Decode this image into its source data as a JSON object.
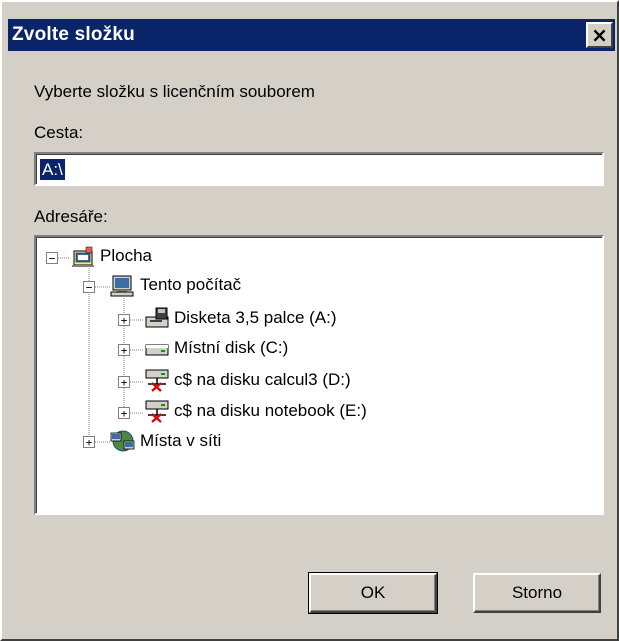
{
  "window": {
    "title": "Zvolte složku",
    "close_symbol": "×"
  },
  "description": "Vyberte složku s licenčním souborem",
  "path": {
    "label": "Cesta:",
    "value": "A:\\"
  },
  "directories": {
    "label": "Adresáře:",
    "tree": [
      {
        "label": "Plocha",
        "icon": "desktop-icon",
        "expander": "−"
      },
      {
        "label": "Tento počítač",
        "icon": "my-computer-icon",
        "expander": "−"
      },
      {
        "label": "Disketa 3,5 palce (A:)",
        "icon": "floppy-drive-icon",
        "expander": "+"
      },
      {
        "label": "Místní disk (C:)",
        "icon": "hard-disk-icon",
        "expander": "+"
      },
      {
        "label": "c$ na disku calcul3 (D:)",
        "icon": "disconnected-network-drive-icon",
        "expander": "+"
      },
      {
        "label": "c$ na disku notebook (E:)",
        "icon": "disconnected-network-drive-icon",
        "expander": "+"
      },
      {
        "label": "Místa v síti",
        "icon": "network-places-icon",
        "expander": "+"
      }
    ]
  },
  "buttons": {
    "ok": "OK",
    "cancel": "Storno"
  },
  "colors": {
    "titlebar": "#0a246a",
    "face": "#d4d0c8",
    "selection": "#0a246a"
  }
}
